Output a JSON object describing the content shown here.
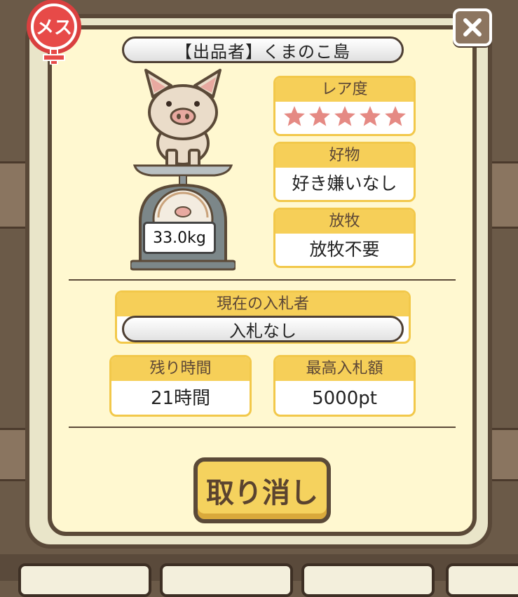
{
  "seller": {
    "label": "【出品者】くまのこ島"
  },
  "gender": {
    "label": "メス",
    "icon": "female-icon"
  },
  "weight": {
    "value": "33.0kg"
  },
  "rarity": {
    "label": "レア度",
    "stars": 5
  },
  "favorite": {
    "label": "好物",
    "value": "好き嫌いなし"
  },
  "grazing": {
    "label": "放牧",
    "value": "放牧不要"
  },
  "current_bidder": {
    "label": "現在の入札者",
    "value": "入札なし"
  },
  "time_left": {
    "label": "残り時間",
    "value": "21時間"
  },
  "highest_bid": {
    "label": "最高入札額",
    "value": "5000pt"
  },
  "actions": {
    "cancel_label": "取り消し"
  },
  "colors": {
    "accent": "#f6cf58",
    "border": "#5b4a38",
    "panel": "#fff8d0",
    "star": "#e58a84"
  }
}
